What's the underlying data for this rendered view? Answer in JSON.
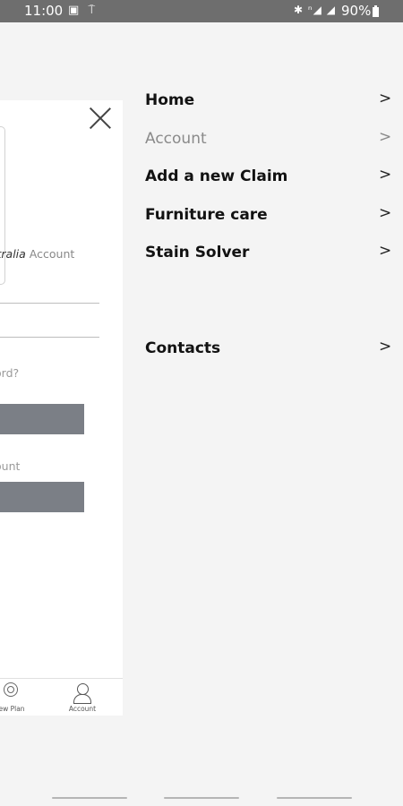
{
  "status_bar": {
    "time": "11:00",
    "left_icons": "▣ ⍑",
    "right_icons": "✱ ⁿ◢ ◢",
    "battery": "90%"
  },
  "behind_page": {
    "link_account_text_prefix": "stralia",
    "link_account_text_suffix": " Account",
    "forgot_text": "ord?",
    "create_text": "ount",
    "tabs": {
      "plan_label": "ew Plan",
      "account_label": "Account"
    }
  },
  "menu": {
    "items": [
      {
        "label": "Home",
        "chevron": ">"
      },
      {
        "label": "Account",
        "chevron": ">"
      },
      {
        "label": "Add a new Claim",
        "chevron": ">"
      },
      {
        "label": "Furniture care",
        "chevron": ">"
      },
      {
        "label": "Stain Solver",
        "chevron": ">"
      },
      {
        "label": "Contacts",
        "chevron": ">"
      }
    ]
  },
  "colors": {
    "status_bar": "#6e6e6e",
    "drawer_background": "#f4f4f4",
    "button_grey": "#7b7f86",
    "muted_text": "#8a8a8a"
  }
}
